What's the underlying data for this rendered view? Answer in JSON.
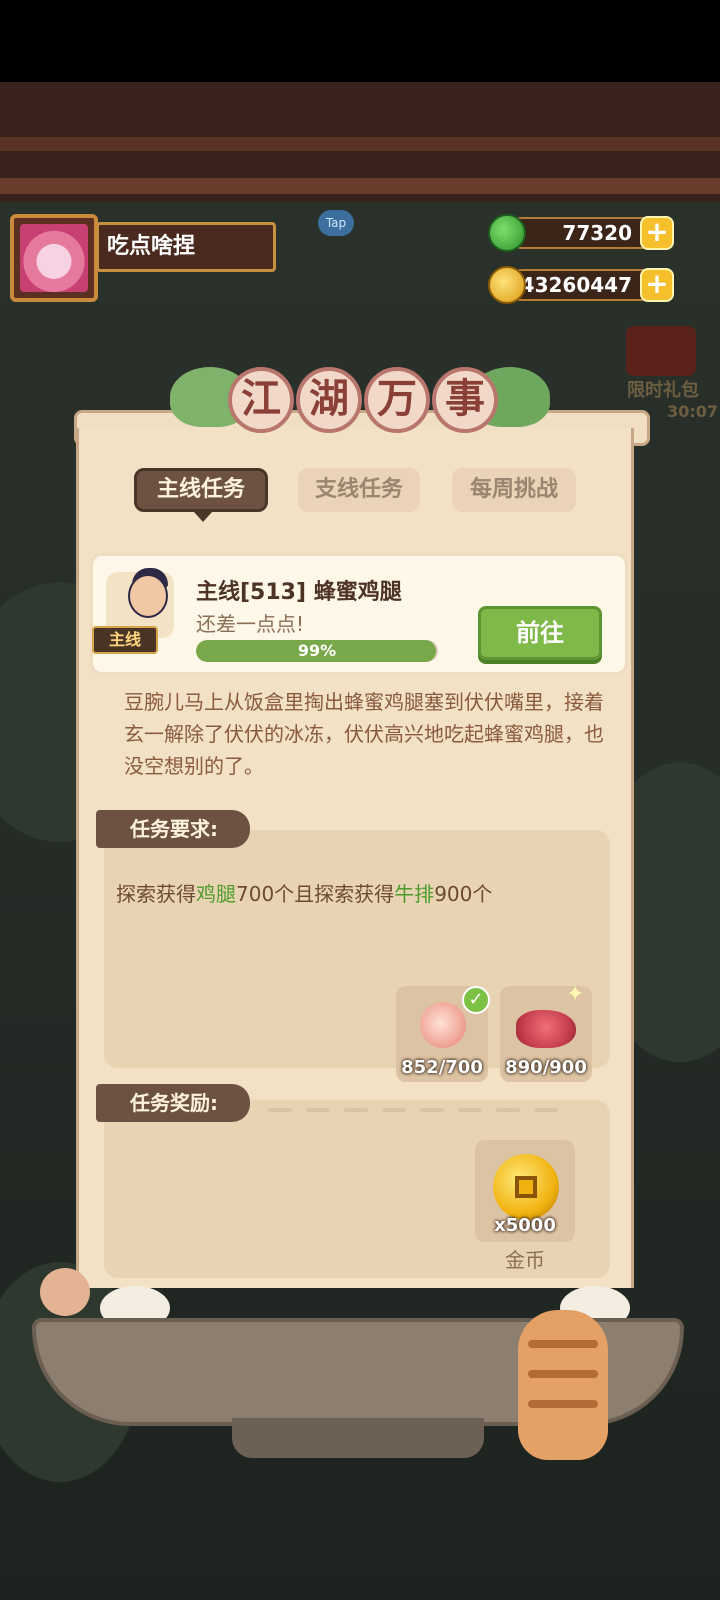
{
  "header": {
    "player_name": "吃点啥捏",
    "tap_label": "Tap",
    "jade_amount": "77320",
    "coin_amount": "43260447",
    "plus_label": "+",
    "gift_label": "限时礼包",
    "gift_timer": "30:07"
  },
  "title": [
    "江",
    "湖",
    "万",
    "事"
  ],
  "tabs": [
    {
      "label": "主线任务",
      "active": true
    },
    {
      "label": "支线任务",
      "active": false
    },
    {
      "label": "每周挑战",
      "active": false
    }
  ],
  "quest": {
    "badge": "主线",
    "title": "主线[513] 蜂蜜鸡腿",
    "subtitle": "还差一点点!",
    "progress_text": "99%",
    "progress_value": 0.99,
    "go_button": "前往",
    "description": "豆腕儿马上从饭盒里掏出蜂蜜鸡腿塞到伏伏嘴里，接着玄一解除了伏伏的冰冻，伏伏高兴地吃起蜂蜜鸡腿，也没空想别的了。"
  },
  "requirements": {
    "label": "任务要求:",
    "text_parts": [
      "探索获得",
      "鸡腿",
      "700个且探索获得",
      "牛排",
      "900个"
    ],
    "items": [
      {
        "name": "drumstick",
        "count": "852/700",
        "done": true
      },
      {
        "name": "steak",
        "count": "890/900",
        "done": false
      }
    ]
  },
  "rewards": {
    "label": "任务奖励:",
    "items": [
      {
        "icon": "gold-coin-icon",
        "count": "x5000",
        "name": "金币"
      }
    ]
  },
  "colors": {
    "highlight_green": "#4e9a2b",
    "panel": "#f3e1c5",
    "tab_active": "#6d5243"
  }
}
